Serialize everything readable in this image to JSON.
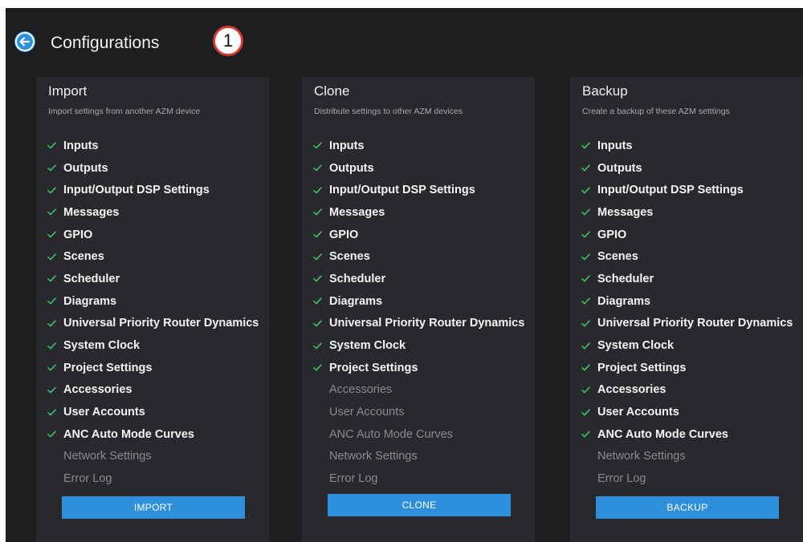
{
  "header": {
    "title": "Configurations",
    "callout_number": "1"
  },
  "panels": [
    {
      "id": "import",
      "title": "Import",
      "description": "Import settings from another AZM device",
      "items": [
        {
          "label": "Inputs",
          "checked": true
        },
        {
          "label": "Outputs",
          "checked": true
        },
        {
          "label": "Input/Output DSP Settings",
          "checked": true
        },
        {
          "label": "Messages",
          "checked": true
        },
        {
          "label": "GPIO",
          "checked": true
        },
        {
          "label": "Scenes",
          "checked": true
        },
        {
          "label": "Scheduler",
          "checked": true
        },
        {
          "label": "Diagrams",
          "checked": true
        },
        {
          "label": "Universal Priority Router Dynamics",
          "checked": true
        },
        {
          "label": "System Clock",
          "checked": true
        },
        {
          "label": "Project Settings",
          "checked": true
        },
        {
          "label": "Accessories",
          "checked": true
        },
        {
          "label": "User Accounts",
          "checked": true
        },
        {
          "label": "ANC Auto Mode Curves",
          "checked": true
        },
        {
          "label": "Network Settings",
          "checked": false
        },
        {
          "label": "Error Log",
          "checked": false
        }
      ],
      "button_label": "IMPORT"
    },
    {
      "id": "clone",
      "title": "Clone",
      "description": "Distribute settings to other AZM devices",
      "items": [
        {
          "label": "Inputs",
          "checked": true
        },
        {
          "label": "Outputs",
          "checked": true
        },
        {
          "label": "Input/Output DSP Settings",
          "checked": true
        },
        {
          "label": "Messages",
          "checked": true
        },
        {
          "label": "GPIO",
          "checked": true
        },
        {
          "label": "Scenes",
          "checked": true
        },
        {
          "label": "Scheduler",
          "checked": true
        },
        {
          "label": "Diagrams",
          "checked": true
        },
        {
          "label": "Universal Priority Router Dynamics",
          "checked": true
        },
        {
          "label": "System Clock",
          "checked": true
        },
        {
          "label": "Project Settings",
          "checked": true
        },
        {
          "label": "Accessories",
          "checked": false
        },
        {
          "label": "User Accounts",
          "checked": false
        },
        {
          "label": "ANC Auto Mode Curves",
          "checked": false
        },
        {
          "label": "Network Settings",
          "checked": false
        },
        {
          "label": "Error Log",
          "checked": false
        }
      ],
      "button_label": "CLONE"
    },
    {
      "id": "backup",
      "title": "Backup",
      "description": "Create a backup of these AZM setttings",
      "items": [
        {
          "label": "Inputs",
          "checked": true
        },
        {
          "label": "Outputs",
          "checked": true
        },
        {
          "label": "Input/Output DSP Settings",
          "checked": true
        },
        {
          "label": "Messages",
          "checked": true
        },
        {
          "label": "GPIO",
          "checked": true
        },
        {
          "label": "Scenes",
          "checked": true
        },
        {
          "label": "Scheduler",
          "checked": true
        },
        {
          "label": "Diagrams",
          "checked": true
        },
        {
          "label": "Universal Priority Router Dynamics",
          "checked": true
        },
        {
          "label": "System Clock",
          "checked": true
        },
        {
          "label": "Project Settings",
          "checked": true
        },
        {
          "label": "Accessories",
          "checked": true
        },
        {
          "label": "User Accounts",
          "checked": true
        },
        {
          "label": "ANC Auto Mode Curves",
          "checked": true
        },
        {
          "label": "Network Settings",
          "checked": false
        },
        {
          "label": "Error Log",
          "checked": false
        }
      ],
      "button_label": "BACKUP"
    }
  ],
  "icons": {
    "back": "arrow-left-circle-icon",
    "check": "checkmark-icon"
  },
  "colors": {
    "accent": "#2e8fdb",
    "check": "#3fbf6a",
    "background": "#1d1e20",
    "panel": "#28292c",
    "callout_border": "#d63a2e"
  }
}
